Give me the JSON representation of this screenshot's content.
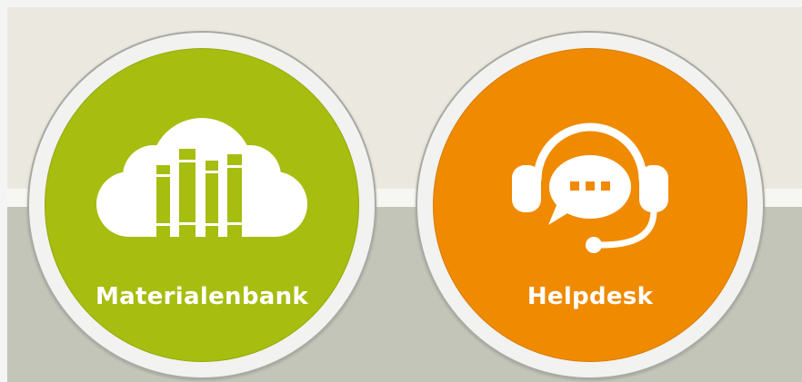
{
  "colors": {
    "top_band": "#ebe9df",
    "bottom_band": "#c4c5b9",
    "materialenbank": "#a7bd0f",
    "helpdesk": "#f08a00",
    "label_text": "#ffffff"
  },
  "tiles": [
    {
      "label": "Materialenbank",
      "icon": "cloud-books-icon"
    },
    {
      "label": "Helpdesk",
      "icon": "headset-chat-icon"
    }
  ]
}
